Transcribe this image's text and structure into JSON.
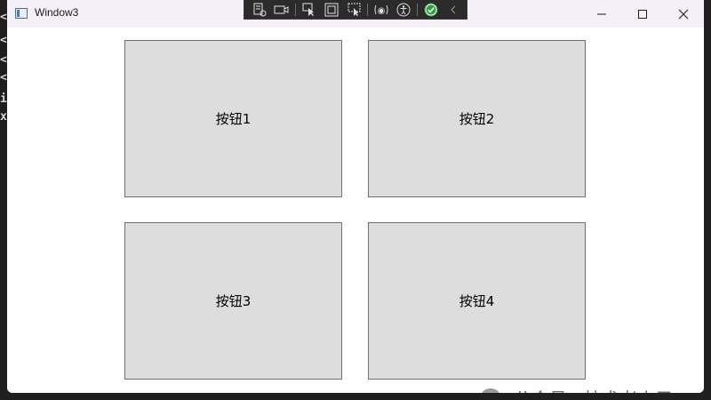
{
  "window": {
    "title": "Window3",
    "controls": {
      "minimize_icon": "minimize-icon",
      "maximize_icon": "maximize-icon",
      "close_icon": "close-icon"
    }
  },
  "debug_toolbar": {
    "items": [
      "live-visual-tree-icon",
      "record-icon",
      "select-element-icon",
      "display-layout-adorners-icon",
      "track-focus-icon",
      "hot-reload-icon",
      "accessibility-icon",
      "binding-check-icon",
      "collapse-chevron-icon"
    ]
  },
  "buttons": {
    "b1": "按钮1",
    "b2": "按钮2",
    "b3": "按钮3",
    "b4": "按钮4"
  },
  "watermark": {
    "text": "公众号 · 技术老小子"
  },
  "background_editor": {
    "lines": [
      "<",
      "<",
      "<",
      "<",
      "i",
      "x"
    ]
  },
  "colors": {
    "titlebar": "#f5f0f8",
    "button_bg": "#dddddd",
    "button_border": "#707070",
    "toolbar_bg": "#2b2b2b",
    "check_green": "#2e9e3a"
  }
}
